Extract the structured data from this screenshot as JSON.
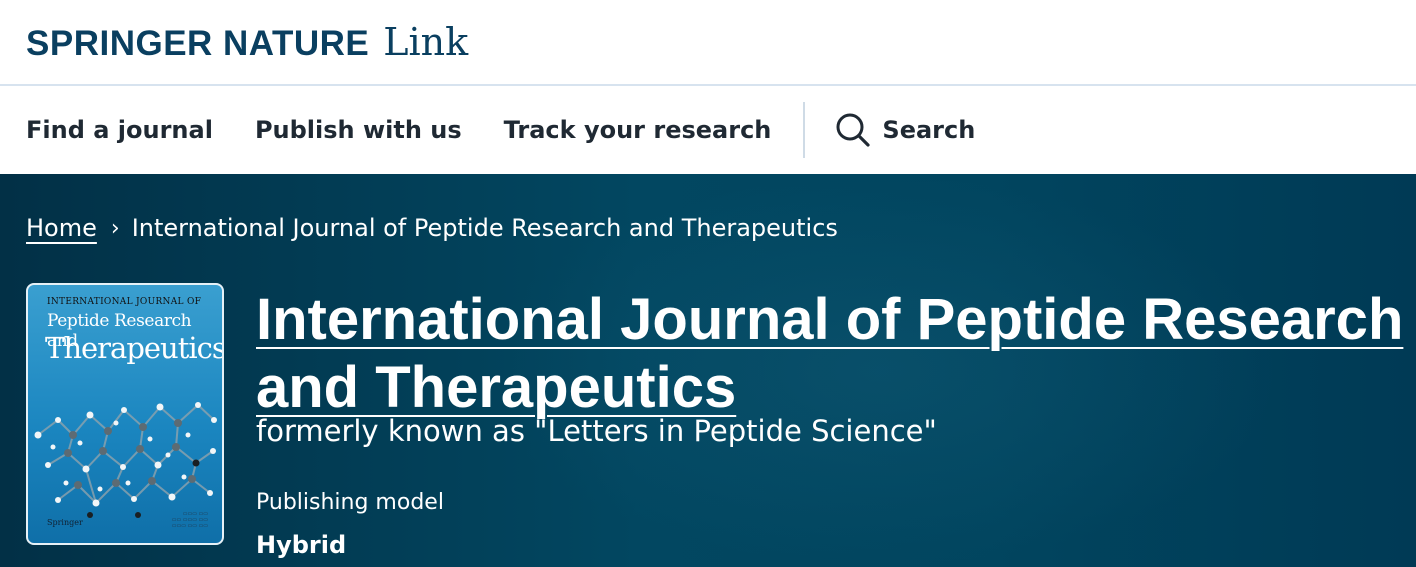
{
  "header": {
    "logo_primary": "SPRINGER NATURE",
    "logo_secondary": "Link"
  },
  "nav": {
    "items": [
      "Find a journal",
      "Publish with us",
      "Track your research"
    ],
    "search_label": "Search",
    "search_icon": "search-icon"
  },
  "breadcrumb": {
    "home": "Home",
    "separator": "›",
    "current": "International Journal of Peptide Research and Therapeutics"
  },
  "journal": {
    "title": "International Journal of Peptide Research and Therapeutics",
    "formerly": "formerly known as \"Letters in Peptide Science\"",
    "publishing_model_label": "Publishing model",
    "publishing_model_value": "Hybrid"
  },
  "cover": {
    "line1": "INTERNATIONAL JOURNAL OF",
    "line2": "Peptide Research and",
    "line3": "Therapeutics",
    "publisher": "Springer"
  },
  "colors": {
    "brand_navy": "#0a3f60",
    "hero_bg": "#024761",
    "nav_text": "#1f2933",
    "cover_blue": "#1b86c0"
  }
}
